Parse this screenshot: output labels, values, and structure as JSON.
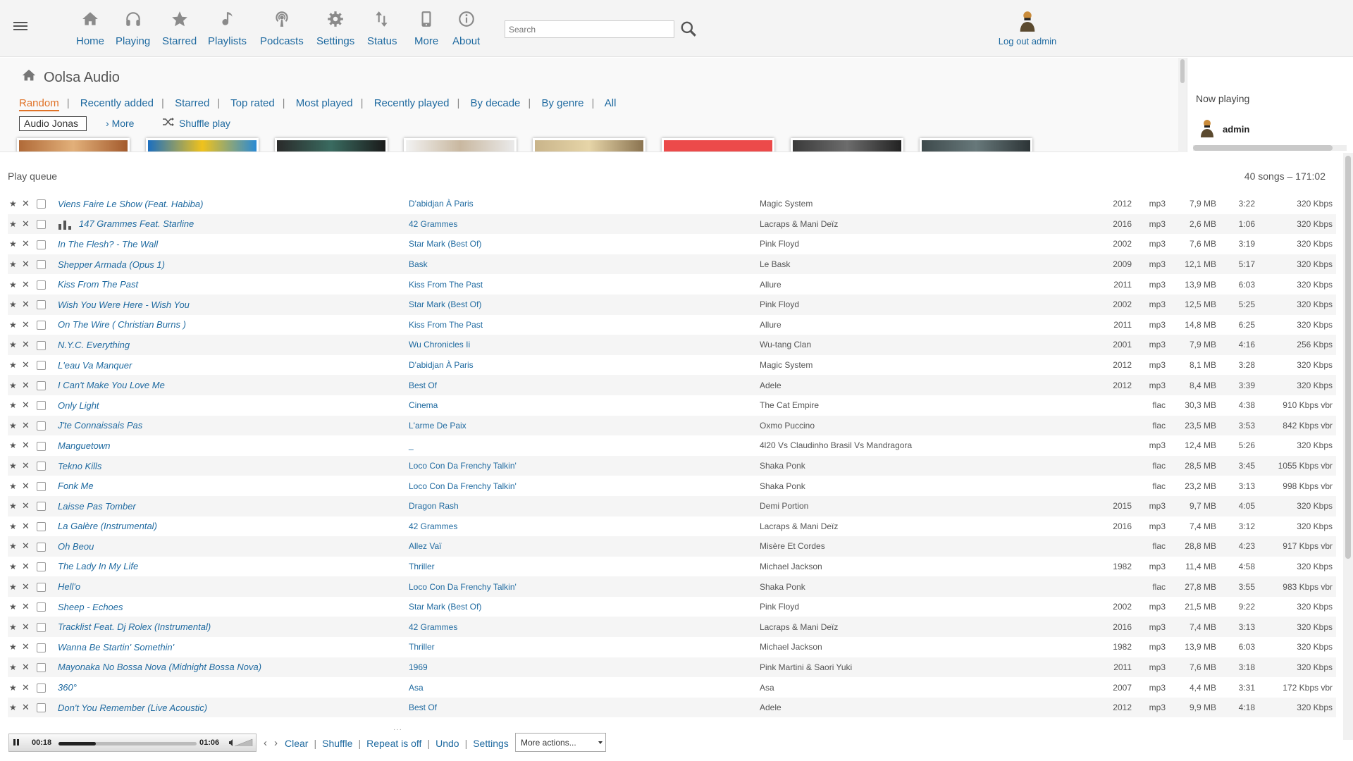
{
  "nav": {
    "items": [
      {
        "label": "Home",
        "icon": "home-icon"
      },
      {
        "label": "Playing",
        "icon": "headphones-icon"
      },
      {
        "label": "Starred",
        "icon": "star-icon"
      },
      {
        "label": "Playlists",
        "icon": "music-note-icon"
      },
      {
        "label": "Podcasts",
        "icon": "podcast-icon"
      },
      {
        "label": "Settings",
        "icon": "gear-icon"
      },
      {
        "label": "Status",
        "icon": "status-arrows-icon"
      },
      {
        "label": "More",
        "icon": "phone-icon"
      },
      {
        "label": "About",
        "icon": "info-icon"
      }
    ],
    "search_placeholder": "Search",
    "logout_label": "Log out admin"
  },
  "home": {
    "title": "Oolsa Audio",
    "tabs": [
      "Random",
      "Recently added",
      "Starred",
      "Top rated",
      "Most played",
      "Recently played",
      "By decade",
      "By genre",
      "All"
    ],
    "active_tab": "Random",
    "music_folder": "Audio Jonas",
    "more_label": "More",
    "shuffle_label": "Shuffle play"
  },
  "right_panel": {
    "now_playing_title": "Now playing",
    "user": "admin"
  },
  "queue": {
    "title": "Play queue",
    "summary": "40 songs – 171:02",
    "rows": [
      {
        "title": "Viens Faire Le Show (Feat. Habiba)",
        "album": "D'abidjan À Paris",
        "artist": "Magic System",
        "year": "2012",
        "format": "mp3",
        "size": "7,9 MB",
        "duration": "3:22",
        "bitrate": "320 Kbps",
        "playing": false
      },
      {
        "title": "147 Grammes Feat. Starline",
        "album": "42 Grammes",
        "artist": "Lacraps & Mani Deïz",
        "year": "2016",
        "format": "mp3",
        "size": "2,6 MB",
        "duration": "1:06",
        "bitrate": "320 Kbps",
        "playing": true
      },
      {
        "title": "In The Flesh? - The Wall",
        "album": "Star Mark (Best Of)",
        "artist": "Pink Floyd",
        "year": "2002",
        "format": "mp3",
        "size": "7,6 MB",
        "duration": "3:19",
        "bitrate": "320 Kbps",
        "playing": false
      },
      {
        "title": "Shepper Armada (Opus 1)",
        "album": "Bask",
        "artist": "Le Bask",
        "year": "2009",
        "format": "mp3",
        "size": "12,1 MB",
        "duration": "5:17",
        "bitrate": "320 Kbps",
        "playing": false
      },
      {
        "title": "Kiss From The Past",
        "album": "Kiss From The Past",
        "artist": "Allure",
        "year": "2011",
        "format": "mp3",
        "size": "13,9 MB",
        "duration": "6:03",
        "bitrate": "320 Kbps",
        "playing": false
      },
      {
        "title": "Wish You Were Here - Wish You",
        "album": "Star Mark (Best Of)",
        "artist": "Pink Floyd",
        "year": "2002",
        "format": "mp3",
        "size": "12,5 MB",
        "duration": "5:25",
        "bitrate": "320 Kbps",
        "playing": false
      },
      {
        "title": "On The Wire ( Christian Burns )",
        "album": "Kiss From The Past",
        "artist": "Allure",
        "year": "2011",
        "format": "mp3",
        "size": "14,8 MB",
        "duration": "6:25",
        "bitrate": "320 Kbps",
        "playing": false
      },
      {
        "title": "N.Y.C. Everything",
        "album": "Wu Chronicles Ii",
        "artist": "Wu-tang Clan",
        "year": "2001",
        "format": "mp3",
        "size": "7,9 MB",
        "duration": "4:16",
        "bitrate": "256 Kbps",
        "playing": false
      },
      {
        "title": "L'eau Va Manquer",
        "album": "D'abidjan À Paris",
        "artist": "Magic System",
        "year": "2012",
        "format": "mp3",
        "size": "8,1 MB",
        "duration": "3:28",
        "bitrate": "320 Kbps",
        "playing": false
      },
      {
        "title": "I Can't Make You Love Me",
        "album": "Best Of",
        "artist": "Adele",
        "year": "2012",
        "format": "mp3",
        "size": "8,4 MB",
        "duration": "3:39",
        "bitrate": "320 Kbps",
        "playing": false
      },
      {
        "title": "Only Light",
        "album": "Cinema",
        "artist": "The Cat Empire",
        "year": "",
        "format": "flac",
        "size": "30,3 MB",
        "duration": "4:38",
        "bitrate": "910 Kbps vbr",
        "playing": false
      },
      {
        "title": "J'te Connaissais Pas",
        "album": "L'arme De Paix",
        "artist": "Oxmo Puccino",
        "year": "",
        "format": "flac",
        "size": "23,5 MB",
        "duration": "3:53",
        "bitrate": "842 Kbps vbr",
        "playing": false
      },
      {
        "title": "Manguetown",
        "album": "_",
        "artist": "4l20 Vs Claudinho Brasil Vs Mandragora",
        "year": "",
        "format": "mp3",
        "size": "12,4 MB",
        "duration": "5:26",
        "bitrate": "320 Kbps",
        "playing": false
      },
      {
        "title": "Tekno Kills",
        "album": "Loco Con Da Frenchy Talkin'",
        "artist": "Shaka Ponk",
        "year": "",
        "format": "flac",
        "size": "28,5 MB",
        "duration": "3:45",
        "bitrate": "1055 Kbps vbr",
        "playing": false
      },
      {
        "title": "Fonk Me",
        "album": "Loco Con Da Frenchy Talkin'",
        "artist": "Shaka Ponk",
        "year": "",
        "format": "flac",
        "size": "23,2 MB",
        "duration": "3:13",
        "bitrate": "998 Kbps vbr",
        "playing": false
      },
      {
        "title": "Laisse Pas Tomber",
        "album": "Dragon Rash",
        "artist": "Demi Portion",
        "year": "2015",
        "format": "mp3",
        "size": "9,7 MB",
        "duration": "4:05",
        "bitrate": "320 Kbps",
        "playing": false
      },
      {
        "title": "La Galère (Instrumental)",
        "album": "42 Grammes",
        "artist": "Lacraps & Mani Deïz",
        "year": "2016",
        "format": "mp3",
        "size": "7,4 MB",
        "duration": "3:12",
        "bitrate": "320 Kbps",
        "playing": false
      },
      {
        "title": "Oh Beou",
        "album": "Allez Vaï",
        "artist": "Misère Et Cordes",
        "year": "",
        "format": "flac",
        "size": "28,8 MB",
        "duration": "4:23",
        "bitrate": "917 Kbps vbr",
        "playing": false
      },
      {
        "title": "The Lady In My Life",
        "album": "Thriller",
        "artist": "Michael Jackson",
        "year": "1982",
        "format": "mp3",
        "size": "11,4 MB",
        "duration": "4:58",
        "bitrate": "320 Kbps",
        "playing": false
      },
      {
        "title": "Hell'o",
        "album": "Loco Con Da Frenchy Talkin'",
        "artist": "Shaka Ponk",
        "year": "",
        "format": "flac",
        "size": "27,8 MB",
        "duration": "3:55",
        "bitrate": "983 Kbps vbr",
        "playing": false
      },
      {
        "title": "Sheep - Echoes",
        "album": "Star Mark (Best Of)",
        "artist": "Pink Floyd",
        "year": "2002",
        "format": "mp3",
        "size": "21,5 MB",
        "duration": "9:22",
        "bitrate": "320 Kbps",
        "playing": false
      },
      {
        "title": "Tracklist Feat. Dj Rolex (Instrumental)",
        "album": "42 Grammes",
        "artist": "Lacraps & Mani Deïz",
        "year": "2016",
        "format": "mp3",
        "size": "7,4 MB",
        "duration": "3:13",
        "bitrate": "320 Kbps",
        "playing": false
      },
      {
        "title": "Wanna Be Startin' Somethin'",
        "album": "Thriller",
        "artist": "Michael Jackson",
        "year": "1982",
        "format": "mp3",
        "size": "13,9 MB",
        "duration": "6:03",
        "bitrate": "320 Kbps",
        "playing": false
      },
      {
        "title": "Mayonaka No Bossa Nova (Midnight Bossa Nova)",
        "album": "1969",
        "artist": "Pink Martini & Saori Yuki",
        "year": "2011",
        "format": "mp3",
        "size": "7,6 MB",
        "duration": "3:18",
        "bitrate": "320 Kbps",
        "playing": false
      },
      {
        "title": "360°",
        "album": "Asa",
        "artist": "Asa",
        "year": "2007",
        "format": "mp3",
        "size": "4,4 MB",
        "duration": "3:31",
        "bitrate": "172 Kbps vbr",
        "playing": false
      },
      {
        "title": "Don't You Remember (Live Acoustic)",
        "album": "Best Of",
        "artist": "Adele",
        "year": "2012",
        "format": "mp3",
        "size": "9,9 MB",
        "duration": "4:18",
        "bitrate": "320 Kbps",
        "playing": false
      }
    ]
  },
  "player": {
    "current_time": "00:18",
    "total_time": "01:06",
    "progress_fraction": 0.27,
    "controls": [
      "Clear",
      "Shuffle",
      "Repeat is off",
      "Undo",
      "Settings"
    ],
    "more_actions": "More actions..."
  },
  "colors": {
    "link": "#1f6aa0",
    "active_tab": "#e07328",
    "topbar_bg": "#f4f4f4"
  }
}
